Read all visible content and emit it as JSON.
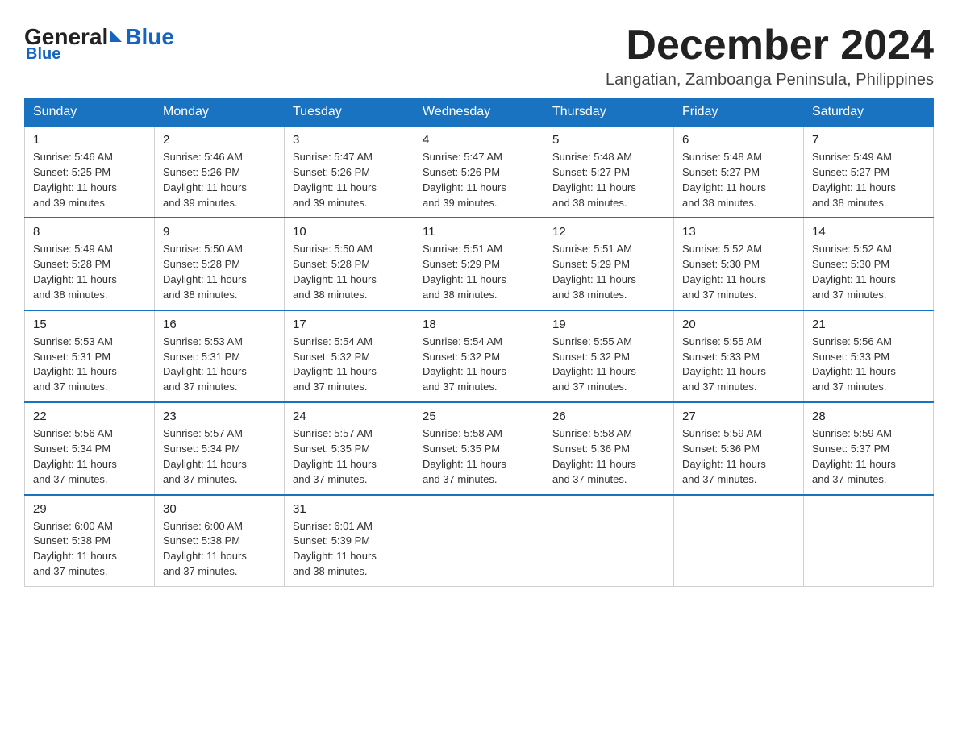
{
  "logo": {
    "general": "General",
    "blue": "Blue"
  },
  "header": {
    "month": "December 2024",
    "location": "Langatian, Zamboanga Peninsula, Philippines"
  },
  "weekdays": [
    "Sunday",
    "Monday",
    "Tuesday",
    "Wednesday",
    "Thursday",
    "Friday",
    "Saturday"
  ],
  "weeks": [
    [
      {
        "day": "1",
        "sunrise": "5:46 AM",
        "sunset": "5:25 PM",
        "daylight": "11 hours and 39 minutes."
      },
      {
        "day": "2",
        "sunrise": "5:46 AM",
        "sunset": "5:26 PM",
        "daylight": "11 hours and 39 minutes."
      },
      {
        "day": "3",
        "sunrise": "5:47 AM",
        "sunset": "5:26 PM",
        "daylight": "11 hours and 39 minutes."
      },
      {
        "day": "4",
        "sunrise": "5:47 AM",
        "sunset": "5:26 PM",
        "daylight": "11 hours and 39 minutes."
      },
      {
        "day": "5",
        "sunrise": "5:48 AM",
        "sunset": "5:27 PM",
        "daylight": "11 hours and 38 minutes."
      },
      {
        "day": "6",
        "sunrise": "5:48 AM",
        "sunset": "5:27 PM",
        "daylight": "11 hours and 38 minutes."
      },
      {
        "day": "7",
        "sunrise": "5:49 AM",
        "sunset": "5:27 PM",
        "daylight": "11 hours and 38 minutes."
      }
    ],
    [
      {
        "day": "8",
        "sunrise": "5:49 AM",
        "sunset": "5:28 PM",
        "daylight": "11 hours and 38 minutes."
      },
      {
        "day": "9",
        "sunrise": "5:50 AM",
        "sunset": "5:28 PM",
        "daylight": "11 hours and 38 minutes."
      },
      {
        "day": "10",
        "sunrise": "5:50 AM",
        "sunset": "5:28 PM",
        "daylight": "11 hours and 38 minutes."
      },
      {
        "day": "11",
        "sunrise": "5:51 AM",
        "sunset": "5:29 PM",
        "daylight": "11 hours and 38 minutes."
      },
      {
        "day": "12",
        "sunrise": "5:51 AM",
        "sunset": "5:29 PM",
        "daylight": "11 hours and 38 minutes."
      },
      {
        "day": "13",
        "sunrise": "5:52 AM",
        "sunset": "5:30 PM",
        "daylight": "11 hours and 37 minutes."
      },
      {
        "day": "14",
        "sunrise": "5:52 AM",
        "sunset": "5:30 PM",
        "daylight": "11 hours and 37 minutes."
      }
    ],
    [
      {
        "day": "15",
        "sunrise": "5:53 AM",
        "sunset": "5:31 PM",
        "daylight": "11 hours and 37 minutes."
      },
      {
        "day": "16",
        "sunrise": "5:53 AM",
        "sunset": "5:31 PM",
        "daylight": "11 hours and 37 minutes."
      },
      {
        "day": "17",
        "sunrise": "5:54 AM",
        "sunset": "5:32 PM",
        "daylight": "11 hours and 37 minutes."
      },
      {
        "day": "18",
        "sunrise": "5:54 AM",
        "sunset": "5:32 PM",
        "daylight": "11 hours and 37 minutes."
      },
      {
        "day": "19",
        "sunrise": "5:55 AM",
        "sunset": "5:32 PM",
        "daylight": "11 hours and 37 minutes."
      },
      {
        "day": "20",
        "sunrise": "5:55 AM",
        "sunset": "5:33 PM",
        "daylight": "11 hours and 37 minutes."
      },
      {
        "day": "21",
        "sunrise": "5:56 AM",
        "sunset": "5:33 PM",
        "daylight": "11 hours and 37 minutes."
      }
    ],
    [
      {
        "day": "22",
        "sunrise": "5:56 AM",
        "sunset": "5:34 PM",
        "daylight": "11 hours and 37 minutes."
      },
      {
        "day": "23",
        "sunrise": "5:57 AM",
        "sunset": "5:34 PM",
        "daylight": "11 hours and 37 minutes."
      },
      {
        "day": "24",
        "sunrise": "5:57 AM",
        "sunset": "5:35 PM",
        "daylight": "11 hours and 37 minutes."
      },
      {
        "day": "25",
        "sunrise": "5:58 AM",
        "sunset": "5:35 PM",
        "daylight": "11 hours and 37 minutes."
      },
      {
        "day": "26",
        "sunrise": "5:58 AM",
        "sunset": "5:36 PM",
        "daylight": "11 hours and 37 minutes."
      },
      {
        "day": "27",
        "sunrise": "5:59 AM",
        "sunset": "5:36 PM",
        "daylight": "11 hours and 37 minutes."
      },
      {
        "day": "28",
        "sunrise": "5:59 AM",
        "sunset": "5:37 PM",
        "daylight": "11 hours and 37 minutes."
      }
    ],
    [
      {
        "day": "29",
        "sunrise": "6:00 AM",
        "sunset": "5:38 PM",
        "daylight": "11 hours and 37 minutes."
      },
      {
        "day": "30",
        "sunrise": "6:00 AM",
        "sunset": "5:38 PM",
        "daylight": "11 hours and 37 minutes."
      },
      {
        "day": "31",
        "sunrise": "6:01 AM",
        "sunset": "5:39 PM",
        "daylight": "11 hours and 38 minutes."
      },
      null,
      null,
      null,
      null
    ]
  ]
}
